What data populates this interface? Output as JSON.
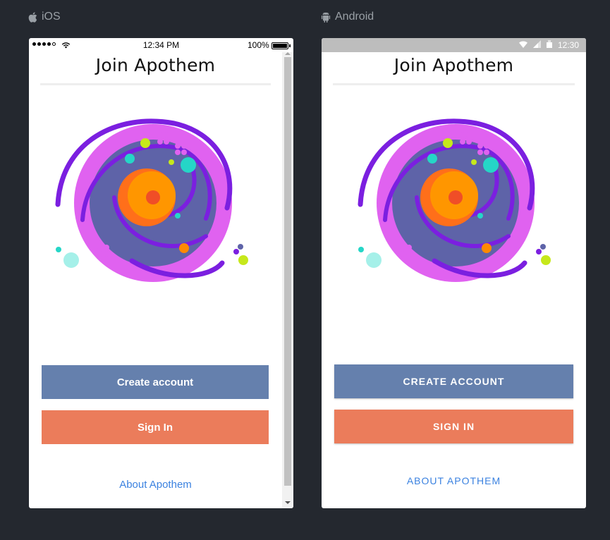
{
  "ios": {
    "platform_label": "iOS",
    "status": {
      "time": "12:34 PM",
      "battery": "100%"
    },
    "title": "Join Apothem",
    "create_account_label": "Create account",
    "sign_in_label": "Sign In",
    "about_label": "About Apothem"
  },
  "android": {
    "platform_label": "Android",
    "status": {
      "time": "12:30"
    },
    "title": "Join Apothem",
    "create_account_label": "CREATE ACCOUNT",
    "sign_in_label": "SIGN IN",
    "about_label": "ABOUT APOTHEM"
  },
  "colors": {
    "background": "#24282f",
    "primary_button": "#6580ad",
    "secondary_button": "#eb7c5b",
    "link": "#3b82e0",
    "galaxy_purple": "#7b1fe0",
    "galaxy_pink": "#e062f0",
    "galaxy_core": "#5e63a8",
    "sun": "#ff8a00"
  },
  "icons": [
    "apple-icon",
    "android-icon",
    "wifi-icon",
    "battery-icon",
    "cell-signal-icon",
    "sim-icon"
  ]
}
